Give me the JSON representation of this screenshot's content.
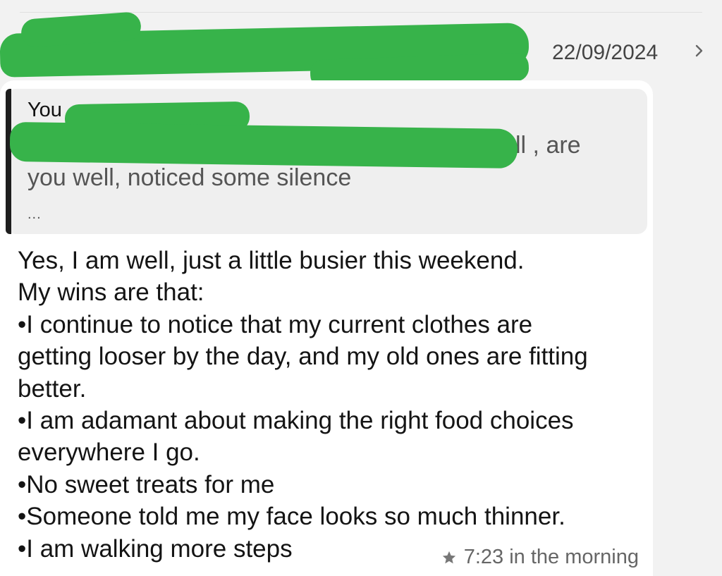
{
  "header": {
    "date": "22/09/2024",
    "chevron_icon": "chevron-right-icon"
  },
  "quoted_reply": {
    "author": "You",
    "visible_fragment": "ll , are",
    "line2": "you well, noticed some silence",
    "ellipsis": "..."
  },
  "message": {
    "lines": [
      "Yes, I am well, just a little busier this weekend.",
      "My wins are that:",
      "•I continue to notice that my current clothes are",
      "getting looser by the day, and my old ones are fitting",
      "better.",
      "•I am adamant about making the right food choices",
      "everywhere I go.",
      "•No sweet treats for me",
      "•Someone told me my face looks so much thinner.",
      "•I am walking more steps"
    ],
    "time": "7:23 in the morning",
    "star_icon": "star-icon"
  },
  "colors": {
    "redaction": "#37b34a",
    "bubble": "#ffffff",
    "quote_bg": "#efefef",
    "quote_bar": "#1e1e1e"
  }
}
